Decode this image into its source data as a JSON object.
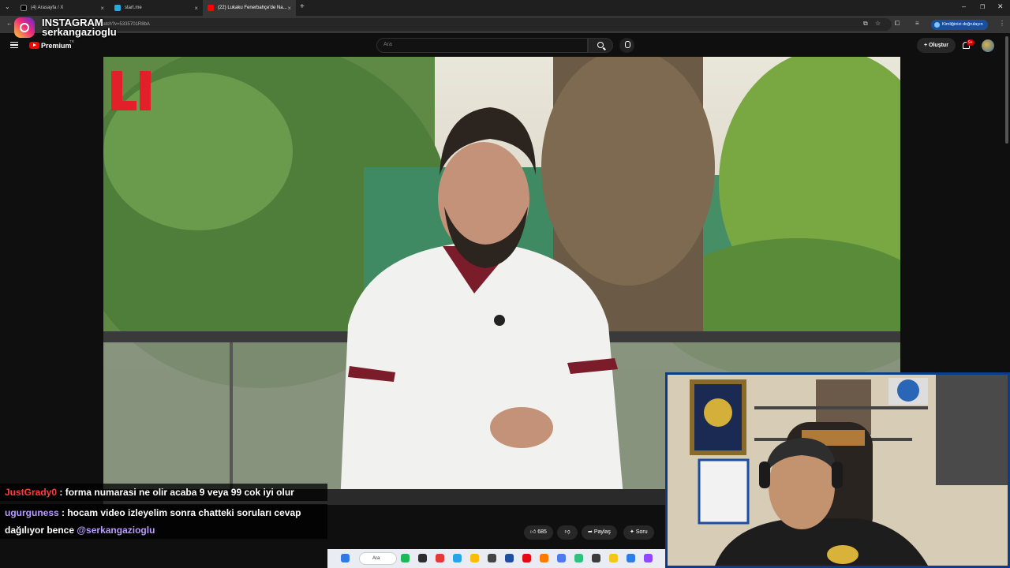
{
  "browser": {
    "tabs": [
      {
        "label": "(4) Arasayfa / X"
      },
      {
        "label": "start.me"
      },
      {
        "label": "(22) Lukaku Fenerbahçe'de Na..."
      }
    ],
    "url": "youtube.com/watch?v=5335701R8bA",
    "verify_label": "Kimliğinizi doğrulayın"
  },
  "overlay": {
    "instagram_title": "INSTAGRAM",
    "instagram_user": "serkangazioglu"
  },
  "youtube": {
    "brand": "Premium",
    "region": "TR",
    "search_placeholder": "Ara",
    "create_label": "+ Oluştur",
    "notification_count": "9+"
  },
  "actions": {
    "likes": "685",
    "share_label": "Paylaş",
    "ask_label": "Soru"
  },
  "chat": [
    {
      "user": "JustGrady0",
      "text": " : forma numarasi ne olir acaba 9 veya 99 cok iyi olur"
    },
    {
      "user": "ugurguness",
      "text": " : hocam video izleyelim sonra chatteki soruları cevap"
    },
    {
      "text": "dağılıyor bence ",
      "mention": "@serkangazioglu"
    }
  ],
  "taskbar": {
    "search_label": "Ara"
  },
  "colors": {
    "youtube_red": "#ff0000",
    "chat_user_1": "#ff3d3d",
    "chat_user_2": "#b99cff",
    "cam_border": "#0a3c8a"
  }
}
